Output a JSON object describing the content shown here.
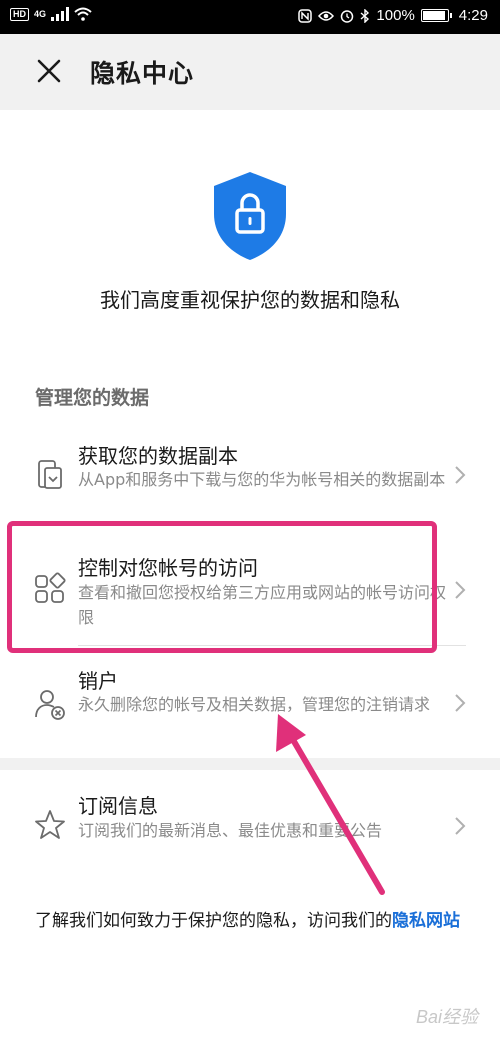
{
  "status_bar": {
    "hd": "HD",
    "network": "4G",
    "battery_text": "100%",
    "battery_level": 1.0,
    "time": "4:29"
  },
  "header": {
    "title": "隐私中心",
    "close_icon": "close-icon"
  },
  "hero": {
    "icon": "shield-lock-icon",
    "text": "我们高度重视保护您的数据和隐私"
  },
  "section": {
    "title": "管理您的数据"
  },
  "items": [
    {
      "icon": "phone-download-icon",
      "title": "获取您的数据副本",
      "desc": "从App和服务中下载与您的华为帐号相关的数据副本"
    },
    {
      "icon": "apps-grid-icon",
      "title": "控制对您帐号的访问",
      "desc": "查看和撤回您授权给第三方应用或网站的帐号访问权限"
    },
    {
      "icon": "user-delete-icon",
      "title": "销户",
      "desc": "永久删除您的帐号及相关数据，管理您的注销请求"
    },
    {
      "icon": "star-icon",
      "title": "订阅信息",
      "desc": "订阅我们的最新消息、最佳优惠和重要公告"
    }
  ],
  "footer": {
    "text": "了解我们如何致力于保护您的隐私，访问我们的",
    "link": "隐私网站"
  },
  "colors": {
    "accent": "#1a6fd8",
    "highlight": "#e0307a",
    "shield": "#1e7be6"
  },
  "watermark": "Bai经验"
}
